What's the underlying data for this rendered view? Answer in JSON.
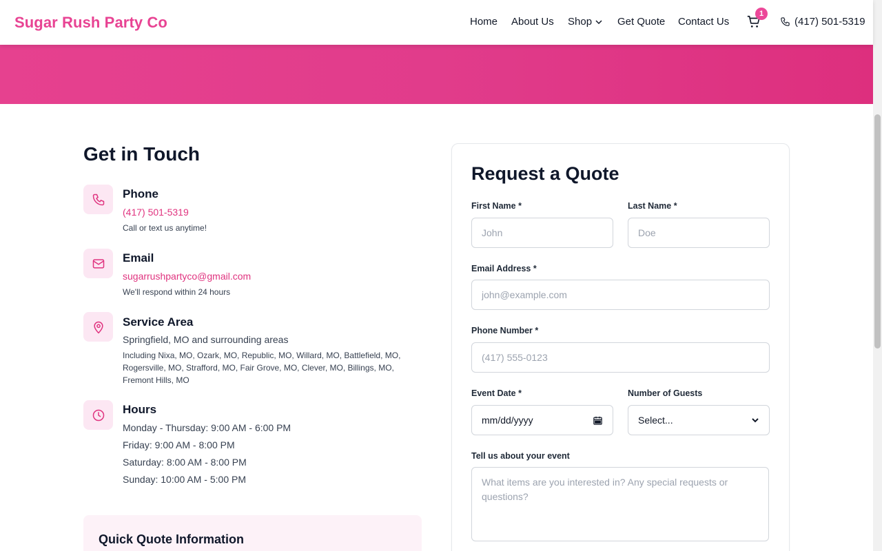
{
  "brand": {
    "name": "Sugar Rush Party Co"
  },
  "nav": {
    "items": [
      "Home",
      "About Us",
      "Shop",
      "Get Quote",
      "Contact Us"
    ],
    "cart_count": "1",
    "phone": "(417) 501-5319"
  },
  "contact": {
    "title": "Get in Touch",
    "phone": {
      "title": "Phone",
      "value": "(417) 501-5319",
      "note": "Call or text us anytime!"
    },
    "email": {
      "title": "Email",
      "value": "sugarrushpartyco@gmail.com",
      "note": "We'll respond within 24 hours"
    },
    "service_area": {
      "title": "Service Area",
      "summary": "Springfield, MO and surrounding areas",
      "details": "Including Nixa, MO, Ozark, MO, Republic, MO, Willard, MO, Battlefield, MO, Rogersville, MO, Strafford, MO, Fair Grove, MO, Clever, MO, Billings, MO, Fremont Hills, MO"
    },
    "hours": {
      "title": "Hours",
      "lines": [
        "Monday - Thursday: 9:00 AM - 6:00 PM",
        "Friday: 9:00 AM - 8:00 PM",
        "Saturday: 8:00 AM - 8:00 PM",
        "Sunday: 10:00 AM - 5:00 PM"
      ]
    },
    "quick_quote_title": "Quick Quote Information"
  },
  "form": {
    "title": "Request a Quote",
    "first_name": {
      "label": "First Name *",
      "placeholder": "John"
    },
    "last_name": {
      "label": "Last Name *",
      "placeholder": "Doe"
    },
    "email": {
      "label": "Email Address *",
      "placeholder": "john@example.com"
    },
    "phone": {
      "label": "Phone Number *",
      "placeholder": "(417) 555-0123"
    },
    "event_date": {
      "label": "Event Date *",
      "value": "mm/dd/yyyy"
    },
    "guests": {
      "label": "Number of Guests",
      "value": "Select..."
    },
    "details": {
      "label": "Tell us about your event",
      "placeholder": "What items are you interested in? Any special requests or questions?"
    }
  },
  "colors": {
    "accent": "#e84393",
    "hero": "#e13c8b",
    "icon_bg": "#fce7f3"
  }
}
